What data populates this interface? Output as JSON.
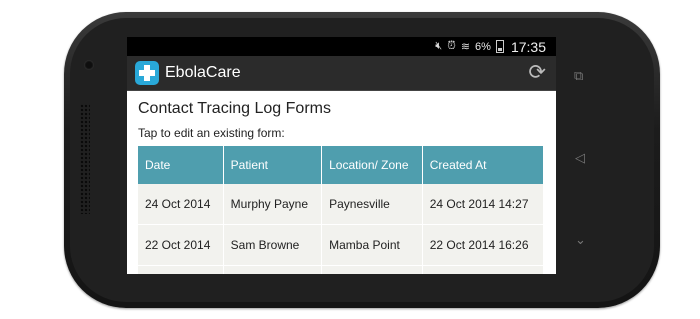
{
  "status_bar": {
    "mute_icon": "mute-icon",
    "alarm_icon": "alarm-icon",
    "wifi_icon": "wifi-icon",
    "battery_percent": "6%",
    "time": "17:35"
  },
  "action_bar": {
    "app_name": "EbolaCare",
    "refresh_icon": "refresh-icon"
  },
  "page": {
    "title": "Contact Tracing Log Forms",
    "instruction": "Tap to edit an existing form:"
  },
  "table": {
    "headers": [
      "Date",
      "Patient",
      "Location/ Zone",
      "Created At"
    ],
    "rows": [
      [
        "24 Oct 2014",
        "Murphy Payne",
        "Paynesville",
        "24 Oct 2014 14:27"
      ],
      [
        "22 Oct 2014",
        "Sam Browne",
        "Mamba Point",
        "22 Oct 2014 16:26"
      ],
      [
        "",
        "",
        "",
        ""
      ]
    ]
  },
  "colors": {
    "header_bg": "#4f9eae",
    "row_bg": "#f2f2ee",
    "app_icon": "#29a8d8"
  }
}
